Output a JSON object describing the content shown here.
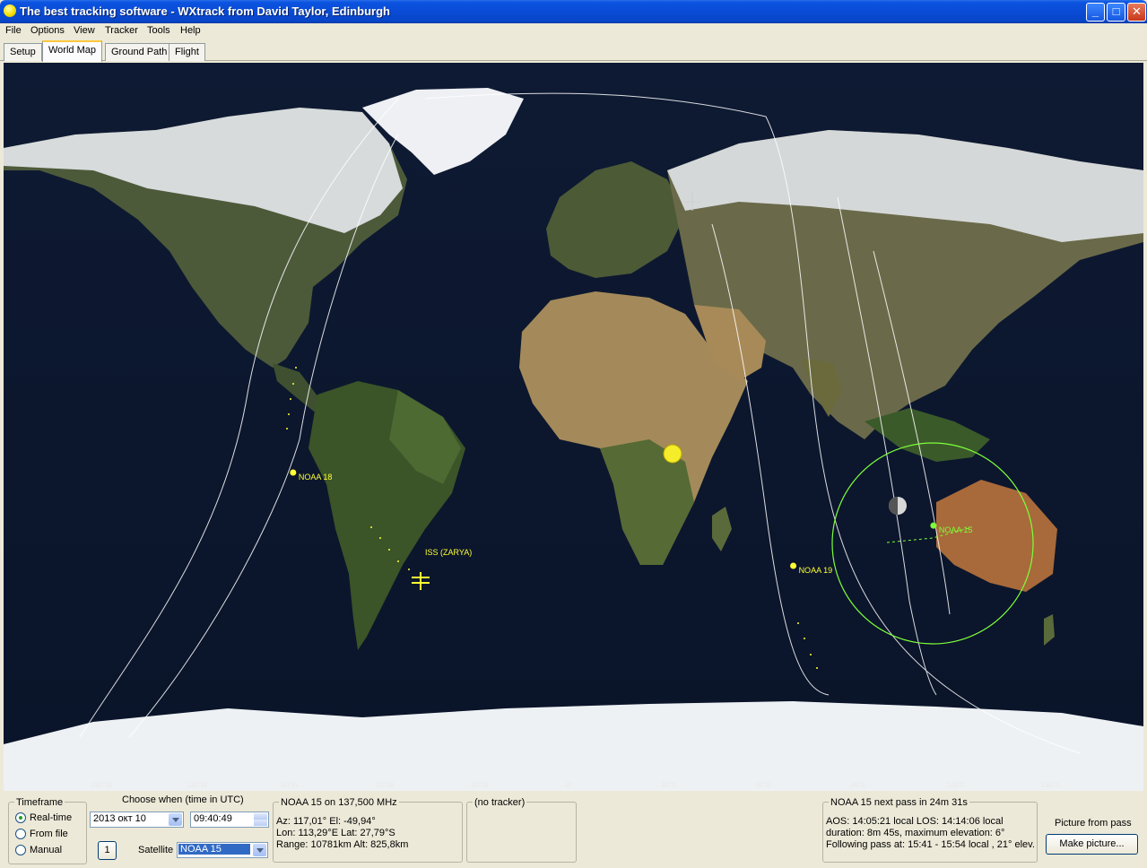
{
  "window": {
    "title": "The best tracking software - WXtrack from David Taylor, Edinburgh",
    "controls": {
      "minimize": "_",
      "maximize": "□",
      "close": "✕"
    }
  },
  "menu": [
    "File",
    "Options",
    "View",
    "Tracker",
    "Tools",
    "Help"
  ],
  "tabs": [
    {
      "label": "Setup",
      "active": false
    },
    {
      "label": "World Map",
      "active": true
    },
    {
      "label": "Ground Path",
      "active": false
    },
    {
      "label": "Flight",
      "active": false
    }
  ],
  "map": {
    "longitude_labels": [
      "150°W",
      "120°W",
      "90°W",
      "60°W",
      "30°W",
      "0°",
      "30°E",
      "60°E",
      "90°E",
      "120°E",
      "150°E"
    ],
    "satellites": [
      {
        "label": "NOAA 18",
        "lon": -89,
        "lat": -13
      },
      {
        "label": "NOAA 19",
        "lon": 69,
        "lat": -39
      },
      {
        "label": "NOAA 15",
        "lon": 113.29,
        "lat": -27.79
      },
      {
        "label": "ISS (ZARYA)",
        "lon": -49,
        "lat": -34
      }
    ],
    "colors": {
      "track": "#ffffff",
      "footprint": "#7dff3a",
      "sat_label": "#ffff33",
      "selected_label": "#7dff3a"
    }
  },
  "timeframe": {
    "title": "Timeframe",
    "options": [
      "Real-time",
      "From file",
      "Manual"
    ],
    "selected": "Real-time"
  },
  "when": {
    "title": "Choose when (time in UTC)",
    "date": "2013 окт 10",
    "time": "09:40:49",
    "step_button": "1",
    "satellite_label": "Satellite",
    "satellite_value": "NOAA 15"
  },
  "satinfo": {
    "title": "NOAA 15 on 137,500 MHz",
    "line1": "Az: 117,01°  El: -49,94°",
    "line2": "Lon: 113,29°E  Lat: 27,79°S",
    "line3": "Range: 10781km  Alt: 825,8km"
  },
  "tracker": {
    "title": "(no tracker)"
  },
  "nextpass": {
    "title": "NOAA 15 next pass in 24m 31s",
    "line1": "AOS: 14:05:21 local  LOS: 14:14:06 local",
    "line2": "duration: 8m 45s,  maximum elevation: 6°",
    "line3": "Following pass at: 15:41 - 15:54 local , 21° elev."
  },
  "picture": {
    "title": "Picture from pass",
    "button": "Make picture..."
  }
}
